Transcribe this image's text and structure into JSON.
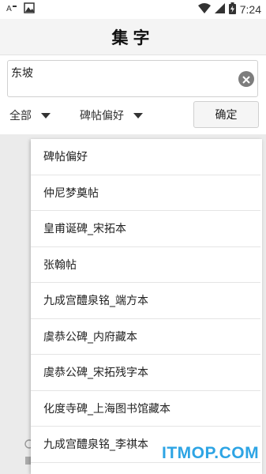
{
  "status_bar": {
    "time": "7:24",
    "icons": [
      "notification-icon",
      "image-icon",
      "wifi-icon",
      "signal-icon",
      "battery-charging-icon"
    ]
  },
  "app_bar": {
    "title": "集字"
  },
  "search": {
    "value": "东坡",
    "placeholder": ""
  },
  "filters": {
    "scope_label": "全部",
    "preference_label": "碑帖偏好",
    "confirm_label": "确定"
  },
  "dropdown": {
    "items": [
      "碑帖偏好",
      "仲尼梦奠帖",
      "皇甫诞碑_宋拓本",
      "张翰帖",
      "九成宫醴泉铭_端方本",
      "虞恭公碑_内府藏本",
      "虞恭公碑_宋拓残字本",
      "化度寺碑_上海图书馆藏本",
      "九成宫醴泉铭_李祺本"
    ]
  },
  "watermark": {
    "text": "ITMOP.COM"
  },
  "colors": {
    "watermark": "#2da4e4",
    "app_bar_bg": "#f4f4f4"
  }
}
